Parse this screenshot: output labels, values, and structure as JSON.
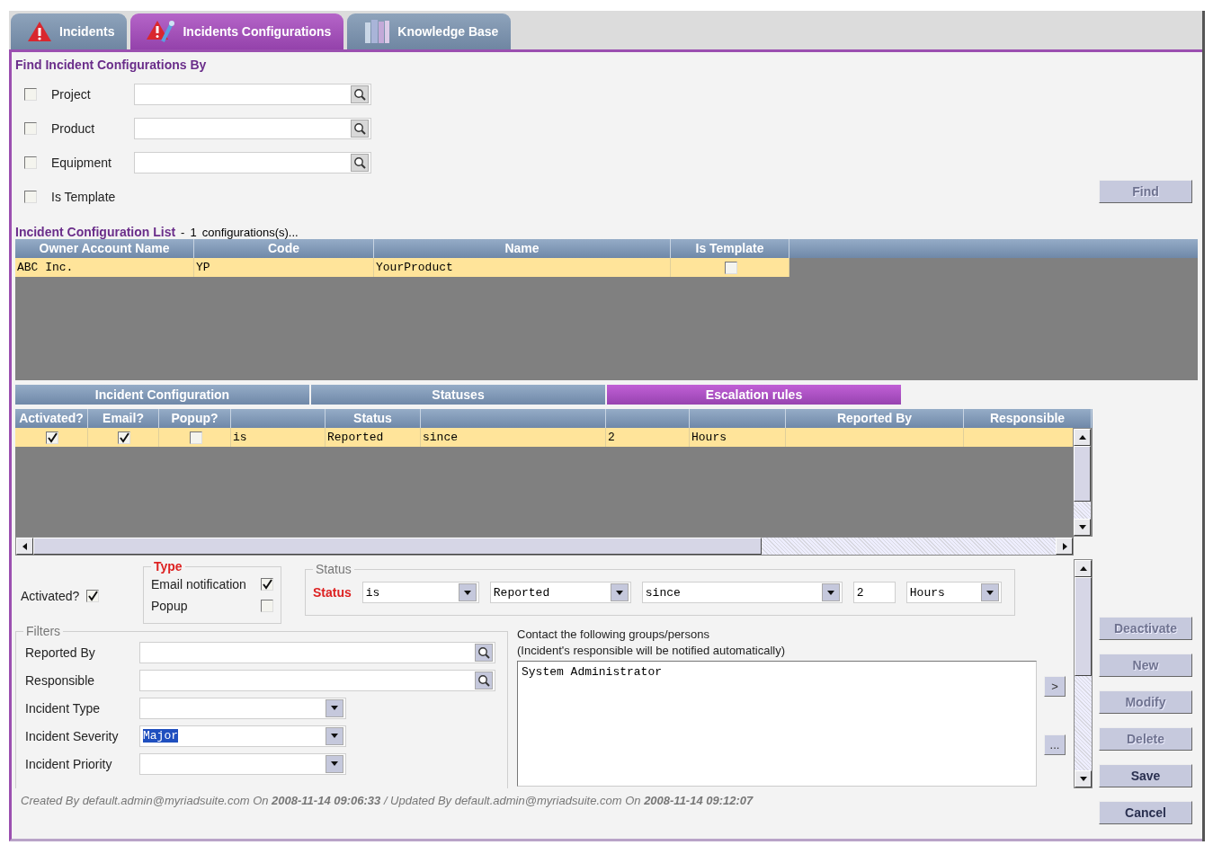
{
  "tabs": [
    {
      "label": "Incidents",
      "kind": "warning",
      "selected": false
    },
    {
      "label": "Incidents Configurations",
      "kind": "warning-tool",
      "selected": true
    },
    {
      "label": "Knowledge Base",
      "kind": "books",
      "selected": false
    }
  ],
  "search": {
    "title": "Find Incident Configurations By",
    "criteria": [
      {
        "label": "Project",
        "kind": "lookup",
        "checked": false
      },
      {
        "label": "Product",
        "kind": "lookup",
        "checked": false
      },
      {
        "label": "Equipment",
        "kind": "lookup",
        "checked": false
      },
      {
        "label": "Is Template",
        "kind": "flag",
        "checked": false
      }
    ],
    "find_button": {
      "label": "Find",
      "disabled": true
    }
  },
  "list": {
    "title": "Incident Configuration List",
    "separator": "-",
    "count": "1",
    "count_label": "configurations(s)...",
    "columns": [
      "Owner Account Name",
      "Code",
      "Name",
      "Is Template"
    ],
    "rows": [
      {
        "selected": true,
        "cells": [
          "ABC Inc.",
          "YP",
          "YourProduct"
        ],
        "is_template": false
      }
    ]
  },
  "subtabs": [
    {
      "label": "Incident Configuration",
      "selected": false
    },
    {
      "label": "Statuses",
      "selected": false
    },
    {
      "label": "Escalation rules",
      "selected": true
    }
  ],
  "escalation_grid": {
    "columns": [
      {
        "label": "Activated?"
      },
      {
        "label": "Email?"
      },
      {
        "label": "Popup?"
      },
      {},
      {
        "label": "Status"
      },
      {},
      {},
      {},
      {
        "label": "Reported By"
      },
      {
        "label": "Responsible"
      }
    ],
    "rows": [
      {
        "selected": true,
        "cells": [
          {
            "kind": "check",
            "checked": true
          },
          {
            "kind": "check",
            "checked": true
          },
          {
            "kind": "check",
            "checked": false
          },
          {
            "kind": "text",
            "text": "is"
          },
          {
            "kind": "text",
            "text": "Reported"
          },
          {
            "kind": "text",
            "text": "since"
          },
          {
            "kind": "text",
            "text": "2"
          },
          {
            "kind": "text",
            "text": "Hours"
          },
          {
            "kind": "empty"
          },
          {
            "kind": "empty"
          }
        ]
      }
    ]
  },
  "rule_form": {
    "activated": {
      "label": "Activated?",
      "checked": true
    },
    "type": {
      "legend": "Type",
      "options": [
        {
          "label": "Email notification",
          "checked": true
        },
        {
          "label": "Popup",
          "checked": false
        }
      ]
    },
    "status": {
      "legend": "Status",
      "label": "Status",
      "operator": "is",
      "status": "Reported",
      "relation": "since",
      "amount": "2",
      "unit": "Hours"
    },
    "filters": {
      "legend": "Filters",
      "fields": [
        {
          "label": "Reported By",
          "kind": "lookup"
        },
        {
          "label": "Responsible",
          "kind": "lookup"
        },
        {
          "label": "Incident Type",
          "kind": "select"
        },
        {
          "label": "Incident Severity",
          "kind": "select",
          "value": "Major",
          "highlighted": true
        },
        {
          "label": "Incident Priority",
          "kind": "select"
        }
      ]
    },
    "contact": {
      "lines": [
        "Contact the following groups/persons",
        "(Incident's responsible will be notified automatically)"
      ],
      "recipients": "System Administrator",
      "add_button": ">",
      "more_button": "..."
    }
  },
  "footer": "Created By default.admin@myriadsuite.com On **2008-11-14 09:06:33**  / Updated By default.admin@myriadsuite.com On **2008-11-14 09:12:07**",
  "actions": [
    {
      "label": "Deactivate",
      "disabled": true
    },
    {
      "label": "New",
      "disabled": true
    },
    {
      "label": "Modify",
      "disabled": true
    },
    {
      "label": "Delete",
      "disabled": true
    },
    {
      "label": "Save",
      "disabled": false
    },
    {
      "label": "Cancel",
      "disabled": false
    }
  ]
}
